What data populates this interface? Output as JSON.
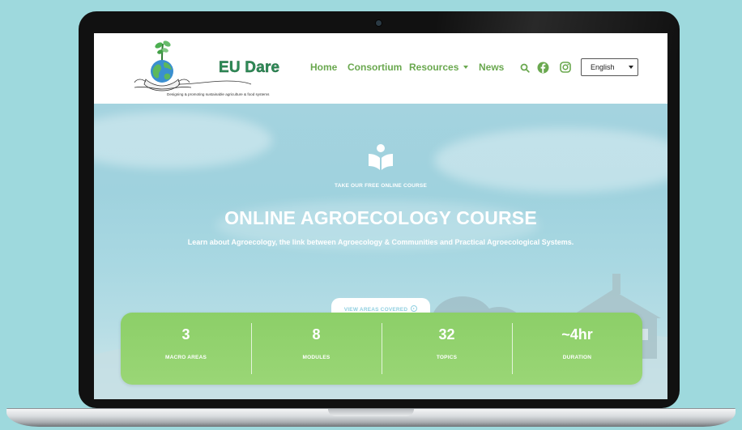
{
  "header": {
    "logo_text": "EU Dare",
    "logo_tagline": "Designing & promoting sustainable agriculture & food systems",
    "nav": [
      {
        "label": "Home"
      },
      {
        "label": "Consortium"
      },
      {
        "label": "Resources",
        "has_dropdown": true
      },
      {
        "label": "News"
      }
    ],
    "icons": [
      "search-icon",
      "facebook-icon",
      "instagram-icon"
    ],
    "language": "English"
  },
  "hero": {
    "icon": "book-reader-icon",
    "eyebrow": "TAKE OUR FREE ONLINE COURSE",
    "title": "ONLINE AGROECOLOGY COURSE",
    "subtitle": "Learn about Agroecology, the link between Agroecology & Communities and Practical Agroecological Systems.",
    "cta": "VIEW AREAS COVERED"
  },
  "stats": [
    {
      "value": "3",
      "label": "MACRO AREAS"
    },
    {
      "value": "8",
      "label": "MODULES"
    },
    {
      "value": "32",
      "label": "TOPICS"
    },
    {
      "value": "~4hr",
      "label": "DURATION"
    }
  ],
  "colors": {
    "page_background": "#9ed9dd",
    "brand_green": "#6aa84f",
    "stats_green": "#8ccf68",
    "hero_sky": "#a4d3df",
    "cta_text": "#8fcfe0"
  }
}
